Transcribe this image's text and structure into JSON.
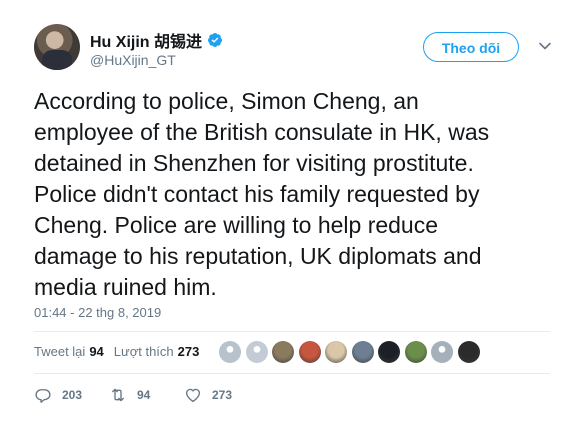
{
  "author": {
    "name": "Hu Xijin 胡锡进",
    "handle": "@HuXijin_GT",
    "verified_color": "#1da1f2"
  },
  "follow_label": "Theo dõi",
  "tweet_lines": [
    "According to police, Simon Cheng, an",
    "employee of the British consulate in HK, was",
    "detained in Shenzhen for visiting prostitute.",
    "Police didn't contact his family requested by",
    "Cheng. Police are willing to help reduce",
    "damage to his reputation, UK diplomats and",
    "media ruined him."
  ],
  "timestamp": "01:44 - 22 thg 8, 2019",
  "stats": {
    "retweets_label": "Tweet lại",
    "retweets": "94",
    "likes_label": "Lượt thích",
    "likes": "273"
  },
  "liker_avatars": [
    {
      "color": "#b8c2cc",
      "icon": "default-avatar"
    },
    {
      "color": "#c3ccd4",
      "icon": "default-avatar"
    },
    {
      "color": "#8a7b5e",
      "icon": "photo-avatar"
    },
    {
      "color": "#c6563d",
      "icon": "photo-avatar"
    },
    {
      "color": "#d9c7a8",
      "icon": "photo-avatar"
    },
    {
      "color": "#6e7f93",
      "icon": "photo-avatar"
    },
    {
      "color": "#1c1f26",
      "icon": "photo-avatar"
    },
    {
      "color": "#6b8f4a",
      "icon": "photo-avatar"
    },
    {
      "color": "#a6b0ba",
      "icon": "default-avatar"
    },
    {
      "color": "#2b2b2b",
      "icon": "photo-avatar"
    }
  ],
  "actions": {
    "replies": "203",
    "retweets": "94",
    "likes": "273"
  },
  "colors": {
    "accent": "#1da1f2",
    "text": "#14171a",
    "muted": "#657786",
    "divider": "#e6ecf0"
  }
}
